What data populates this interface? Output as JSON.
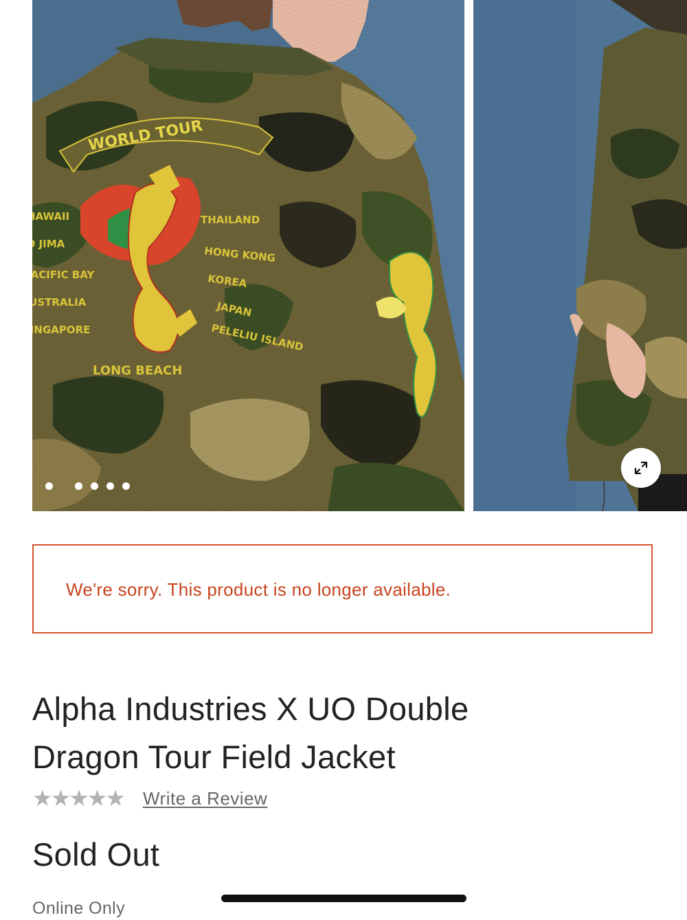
{
  "gallery": {
    "main_image": {
      "embroidery_banner": "WORLD TOUR",
      "places_left": [
        "HAWAII",
        "IO JIMA",
        "PACIFIC BAY",
        "AUSTRALIA",
        "SINGAPORE"
      ],
      "places_right": [
        "THAILAND",
        "HONG KONG",
        "KOREA",
        "JAPAN",
        "PELELIU ISLAND"
      ],
      "bottom_place": "LONG BEACH"
    },
    "dot_count": 5,
    "active_dot": 0
  },
  "alert": {
    "message": "We're sorry. This product is no longer available.",
    "border_color": "#d4512f",
    "text_color": "#c8441f"
  },
  "product": {
    "title_line1": "Alpha Industries X UO Double",
    "title_line2": "Dragon Tour Field Jacket",
    "rating_stars": [
      "★",
      "★",
      "★",
      "★",
      "★"
    ],
    "rating_value": 0,
    "review_link": "Write a Review",
    "price": "Sold Out",
    "availability": "Online Only"
  },
  "icons": {
    "expand": "expand-arrows-icon",
    "star": "star-icon"
  }
}
